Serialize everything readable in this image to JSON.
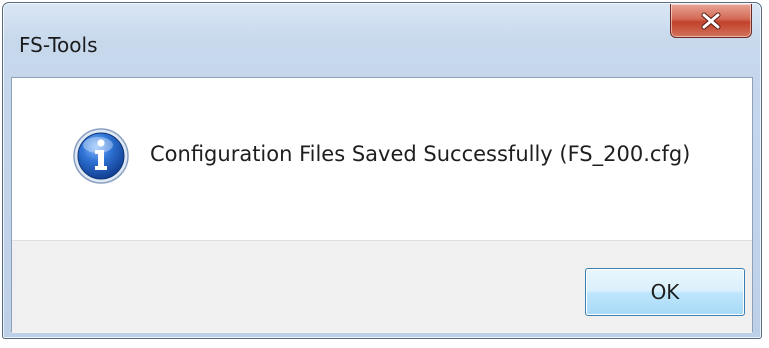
{
  "window": {
    "title": "FS-Tools"
  },
  "titlebar": {
    "close_icon": "close-icon"
  },
  "dialog": {
    "icon": "info-icon",
    "message": "Configuration Files Saved Successfully (FS_200.cfg)",
    "ok_label": "OK"
  },
  "colors": {
    "frame": "#c7d8ec",
    "close_button": "#c2412c",
    "ok_button": "#bee6fd",
    "info_icon": "#1f5fbf"
  }
}
